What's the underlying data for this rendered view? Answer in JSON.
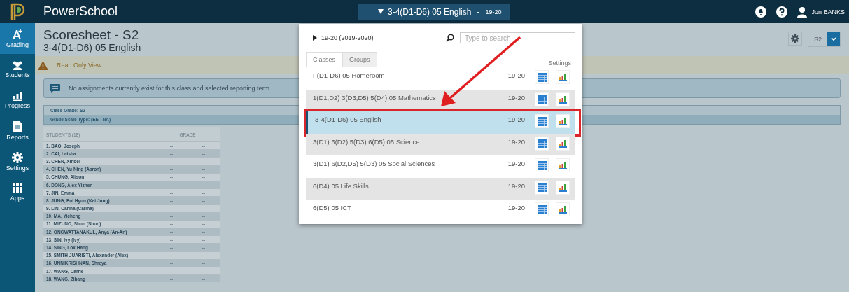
{
  "top_bar": {
    "app_name": "PowerSchool",
    "class_selector": {
      "label": "3-4(D1-D6) 05 English",
      "separator": "-",
      "term": "19-20"
    },
    "user_name": "Jon BANKS"
  },
  "sidebar": {
    "items": [
      {
        "label": "Grading",
        "selected": true
      },
      {
        "label": "Students",
        "selected": false
      },
      {
        "label": "Progress",
        "selected": false
      },
      {
        "label": "Reports",
        "selected": false
      },
      {
        "label": "Settings",
        "selected": false
      },
      {
        "label": "Apps",
        "selected": false
      }
    ]
  },
  "page": {
    "title": "Scoresheet - S2",
    "subtitle": "3-4(D1-D6) 05 English",
    "term_select": "S2",
    "alert": "Read Only View",
    "notice": "No assignments currently exist for this class and selected reporting term.",
    "class_grade": "Class Grade: S2",
    "grade_scale": "Grade Scale Type: (EE - NA)"
  },
  "table": {
    "columns": [
      "STUDENTS (18)",
      "GRADE"
    ],
    "rows": [
      {
        "name": "1. BAO, Joseph",
        "grades": [
          "--",
          "--"
        ]
      },
      {
        "name": "2. CAI, Laisha",
        "grades": [
          "--",
          "--"
        ]
      },
      {
        "name": "3. CHEN, Xinbei",
        "grades": [
          "--",
          "--"
        ]
      },
      {
        "name": "4. CHEN, Yu Ning (Aaron)",
        "grades": [
          "--",
          "--"
        ]
      },
      {
        "name": "5. CHUNG, Alison",
        "grades": [
          "--",
          "--"
        ]
      },
      {
        "name": "6. DONG, Alex Yizhen",
        "grades": [
          "--",
          "--"
        ]
      },
      {
        "name": "7. JIN, Emma",
        "grades": [
          "--",
          "--"
        ]
      },
      {
        "name": "8. JUNG, Eui Hyun (Kai Jung)",
        "grades": [
          "--",
          "--"
        ]
      },
      {
        "name": "9. LIN, Carina (Carina)",
        "grades": [
          "--",
          "--"
        ]
      },
      {
        "name": "10. MA, Yicheng",
        "grades": [
          "--",
          "--"
        ]
      },
      {
        "name": "11. MIZUNO, Shun (Shun)",
        "grades": [
          "--",
          "--"
        ]
      },
      {
        "name": "12. ONGWATTANAKUL, Anya (An-An)",
        "grades": [
          "--",
          "--"
        ]
      },
      {
        "name": "13. SIN, Ivy (Ivy)",
        "grades": [
          "--",
          "--"
        ]
      },
      {
        "name": "14. SING, Lok Hang",
        "grades": [
          "--",
          "--"
        ]
      },
      {
        "name": "15. SMITH JUARISTI, Alexander (Alex)",
        "grades": [
          "--",
          "--"
        ]
      },
      {
        "name": "16. UNNIKRISHNAN, Shreya",
        "grades": [
          "--",
          "--"
        ]
      },
      {
        "name": "17. WANG, Carrie",
        "grades": [
          "--",
          "--"
        ]
      },
      {
        "name": "18. WANG, Zibang",
        "grades": [
          "--",
          "--"
        ]
      }
    ]
  },
  "popup": {
    "year": "19-20 (2019-2020)",
    "search": {
      "placeholder": "Type to search"
    },
    "tabs": [
      {
        "label": "Classes",
        "selected": true
      },
      {
        "label": "Groups",
        "selected": false
      }
    ],
    "settings_label": "Settings",
    "classes": [
      {
        "name": "F(D1-D6) 05 Homeroom",
        "term": "19-20",
        "selected": false
      },
      {
        "name": "1(D1,D2) 3(D3,D5) 5(D4) 05 Mathematics",
        "term": "19-20",
        "selected": false
      },
      {
        "name": "3-4(D1-D6) 05 English",
        "term": "19-20",
        "selected": true
      },
      {
        "name": "3(D1) 6(D2) 5(D3) 6(D5) 05 Science",
        "term": "19-20",
        "selected": false
      },
      {
        "name": "3(D1) 6(D2,D5) 5(D3) 05 Social Sciences",
        "term": "19-20",
        "selected": false
      },
      {
        "name": "6(D4) 05 Life Skills",
        "term": "19-20",
        "selected": false
      },
      {
        "name": "6(D5) 05 ICT",
        "term": "19-20",
        "selected": false
      }
    ]
  }
}
